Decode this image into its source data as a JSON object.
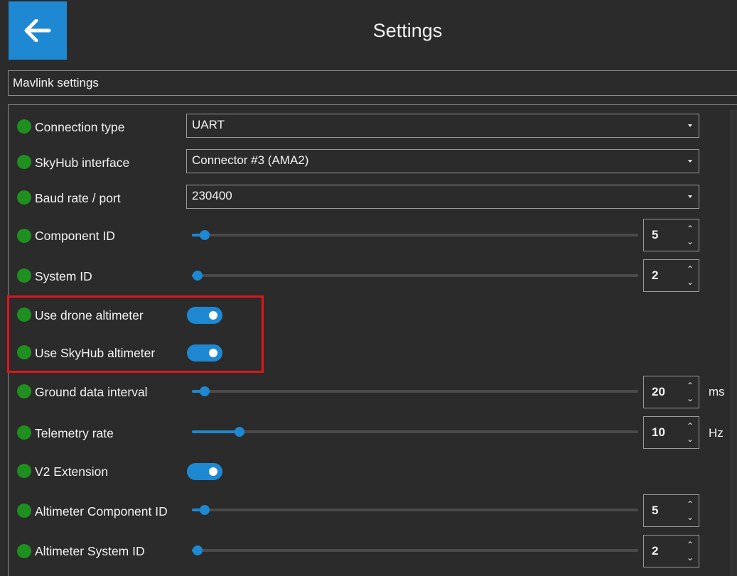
{
  "header": {
    "title": "Settings",
    "back_icon": "arrow-left-icon",
    "accent": "#1e88d2"
  },
  "section": {
    "title": "Mavlink settings"
  },
  "status_color": "#1f8f1f",
  "rows": {
    "connection_type": {
      "label": "Connection type",
      "value": "UART"
    },
    "skyhub_interface": {
      "label": "SkyHub interface",
      "value": "Connector #3 (AMA2)"
    },
    "baud_rate": {
      "label": "Baud rate / port",
      "value": "230400"
    },
    "component_id": {
      "label": "Component ID",
      "value": "5"
    },
    "system_id": {
      "label": "System ID",
      "value": "2"
    },
    "use_drone_altimeter": {
      "label": "Use drone altimeter",
      "checked": true
    },
    "use_skyhub_altimeter": {
      "label": "Use SkyHub altimeter",
      "checked": true
    },
    "ground_data_interval": {
      "label": "Ground data interval",
      "value": "20",
      "unit": "ms"
    },
    "telemetry_rate": {
      "label": "Telemetry rate",
      "value": "10",
      "unit": "Hz"
    },
    "v2_extension": {
      "label": "V2 Extension",
      "checked": true
    },
    "altimeter_component_id": {
      "label": "Altimeter Component ID",
      "value": "5"
    },
    "altimeter_system_id": {
      "label": "Altimeter System ID",
      "value": "2"
    }
  },
  "sliders": {
    "component_id": 0.028,
    "system_id": 0.012,
    "ground_data_interval": 0.028,
    "telemetry_rate": 0.106,
    "altimeter_component_id": 0.028,
    "altimeter_system_id": 0.012
  },
  "highlight_color": "#e0151b"
}
